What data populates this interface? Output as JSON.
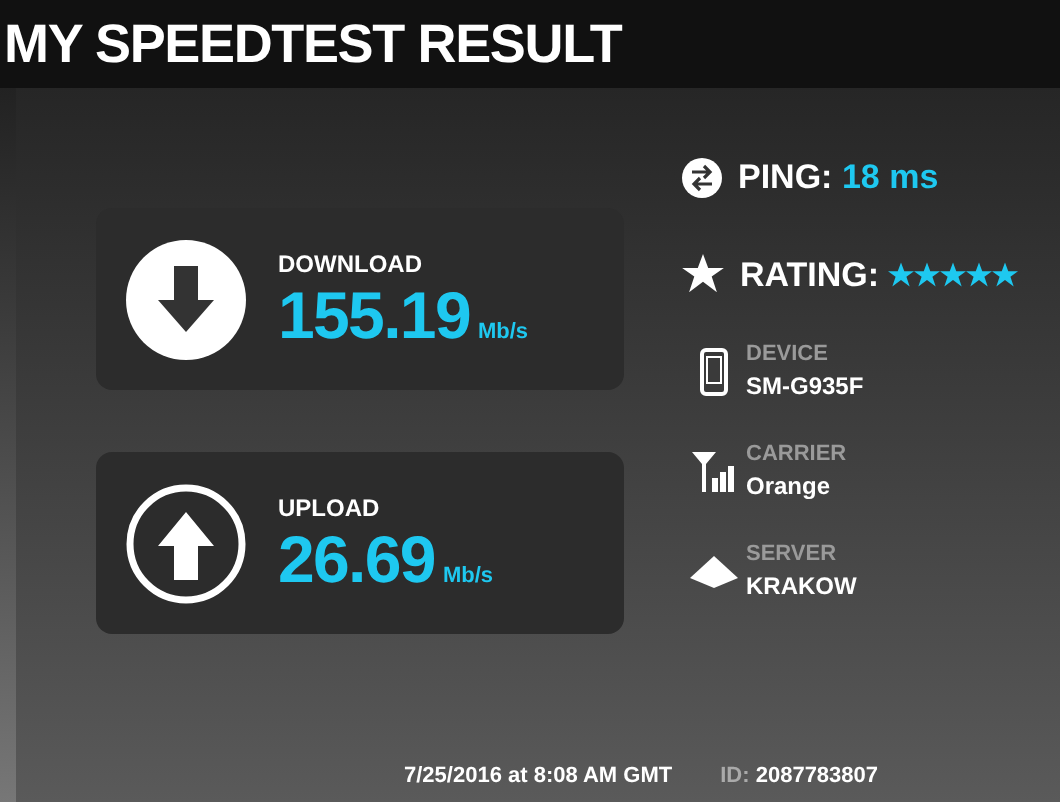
{
  "title": "MY SPEEDTEST RESULT",
  "speeds": [
    {
      "kind": "download",
      "label": "DOWNLOAD",
      "value": "155.19",
      "unit": "Mb/s"
    },
    {
      "kind": "upload",
      "label": "UPLOAD",
      "value": "26.69",
      "unit": "Mb/s"
    }
  ],
  "ping": {
    "label": "PING:",
    "value": "18 ms"
  },
  "rating": {
    "label": "RATING:",
    "stars": 5
  },
  "details": [
    {
      "kind": "device",
      "label": "DEVICE",
      "value": "SM-G935F"
    },
    {
      "kind": "carrier",
      "label": "CARRIER",
      "value": "Orange"
    },
    {
      "kind": "server",
      "label": "SERVER",
      "value": "KRAKOW"
    }
  ],
  "footer": {
    "date": "7/25/2016 at 8:08 AM GMT",
    "id_label": "ID:",
    "id_value": "2087783807"
  }
}
